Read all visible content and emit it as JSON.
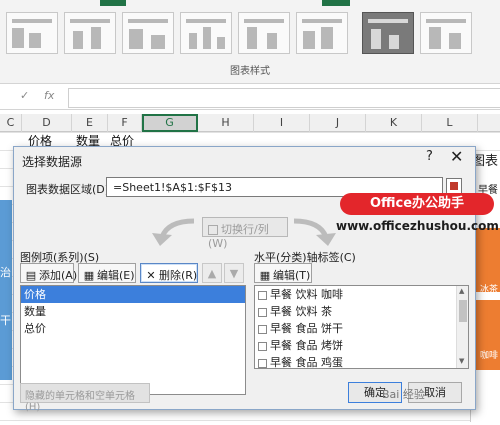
{
  "ribbon": {
    "group_label": "图表样式",
    "accent": "#217346"
  },
  "formula_bar": {
    "cancel_glyph": "✓",
    "fx_label": "fx",
    "value": ""
  },
  "columns": [
    "C",
    "D",
    "E",
    "F",
    "G",
    "H",
    "I",
    "J",
    "K",
    "L"
  ],
  "cells": {
    "d1": "价格",
    "e1": "数量",
    "f1": "总价",
    "a_row8": "治",
    "a_row11": "干",
    "chart_title_partial": "图表",
    "chart_cat_partial": "早餐",
    "chart_label_1": "冰茶",
    "chart_label_2": "咖啡"
  },
  "dialog": {
    "title": "选择数据源",
    "help": "?",
    "close": "✕",
    "range_label": "图表数据区域(D):",
    "range_value": "=Sheet1!$A$1:$F$13",
    "switch_label": "切换行/列(W)",
    "legend_header": "图例项(系列)(S)",
    "axis_header": "水平(分类)轴标签(C)",
    "add_label": "添加(A)",
    "edit_label": "编辑(E)",
    "delete_label": "删除(R)",
    "axis_edit_label": "编辑(T)",
    "series": [
      "价格",
      "数量",
      "总价"
    ],
    "categories": [
      "早餐 饮料 咖啡",
      "早餐 饮料 茶",
      "早餐 食品 饼干",
      "早餐 食品 烤饼",
      "早餐 食品 鸡蛋"
    ],
    "hidden_cells_label": "隐藏的单元格和空单元格(H)",
    "ok_label": "确定",
    "cancel_label": "取消"
  },
  "watermark": {
    "brand": "Office办公助手",
    "url": "www.officezhushou.com",
    "bottom": "Bai 经验"
  },
  "colors": {
    "chart_orange": "#ed7d31",
    "chart_blue": "#5b9bd5",
    "selection": "#3c7fdc",
    "brand_red": "#e3262b"
  }
}
